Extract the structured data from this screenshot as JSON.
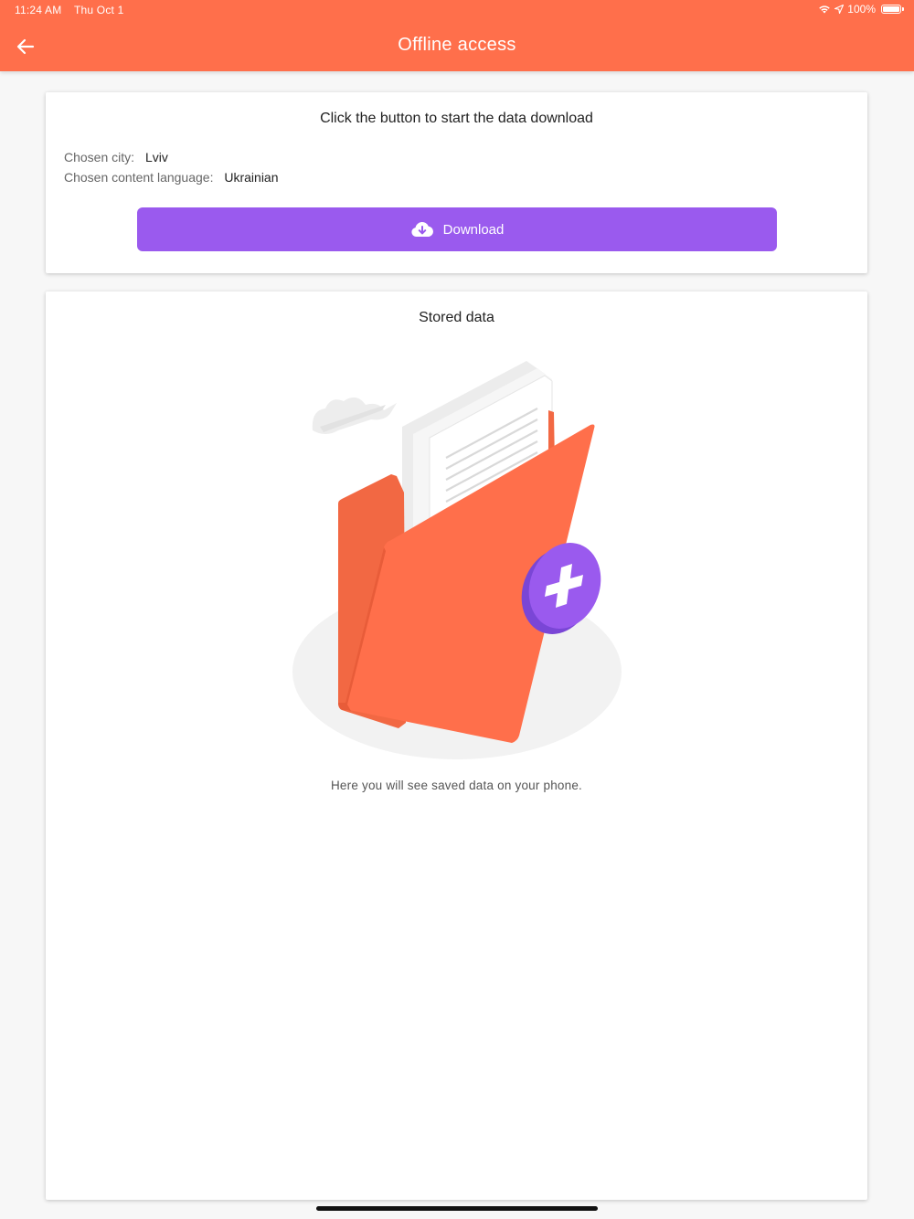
{
  "status_bar": {
    "time": "11:24 AM",
    "date": "Thu Oct 1",
    "battery": "100%"
  },
  "header": {
    "title": "Offline access"
  },
  "download_card": {
    "heading": "Click the button to start the data download",
    "city_label": "Chosen city:",
    "city_value": "Lviv",
    "language_label": "Chosen content language:",
    "language_value": "Ukrainian",
    "button_label": "Download"
  },
  "stored_card": {
    "heading": "Stored data",
    "empty_text": "Here you will see saved data on your phone."
  },
  "colors": {
    "header": "#ff6f4b",
    "button": "#9a5aee",
    "folder": "#ff6f4b",
    "badge": "#8a55e6"
  }
}
